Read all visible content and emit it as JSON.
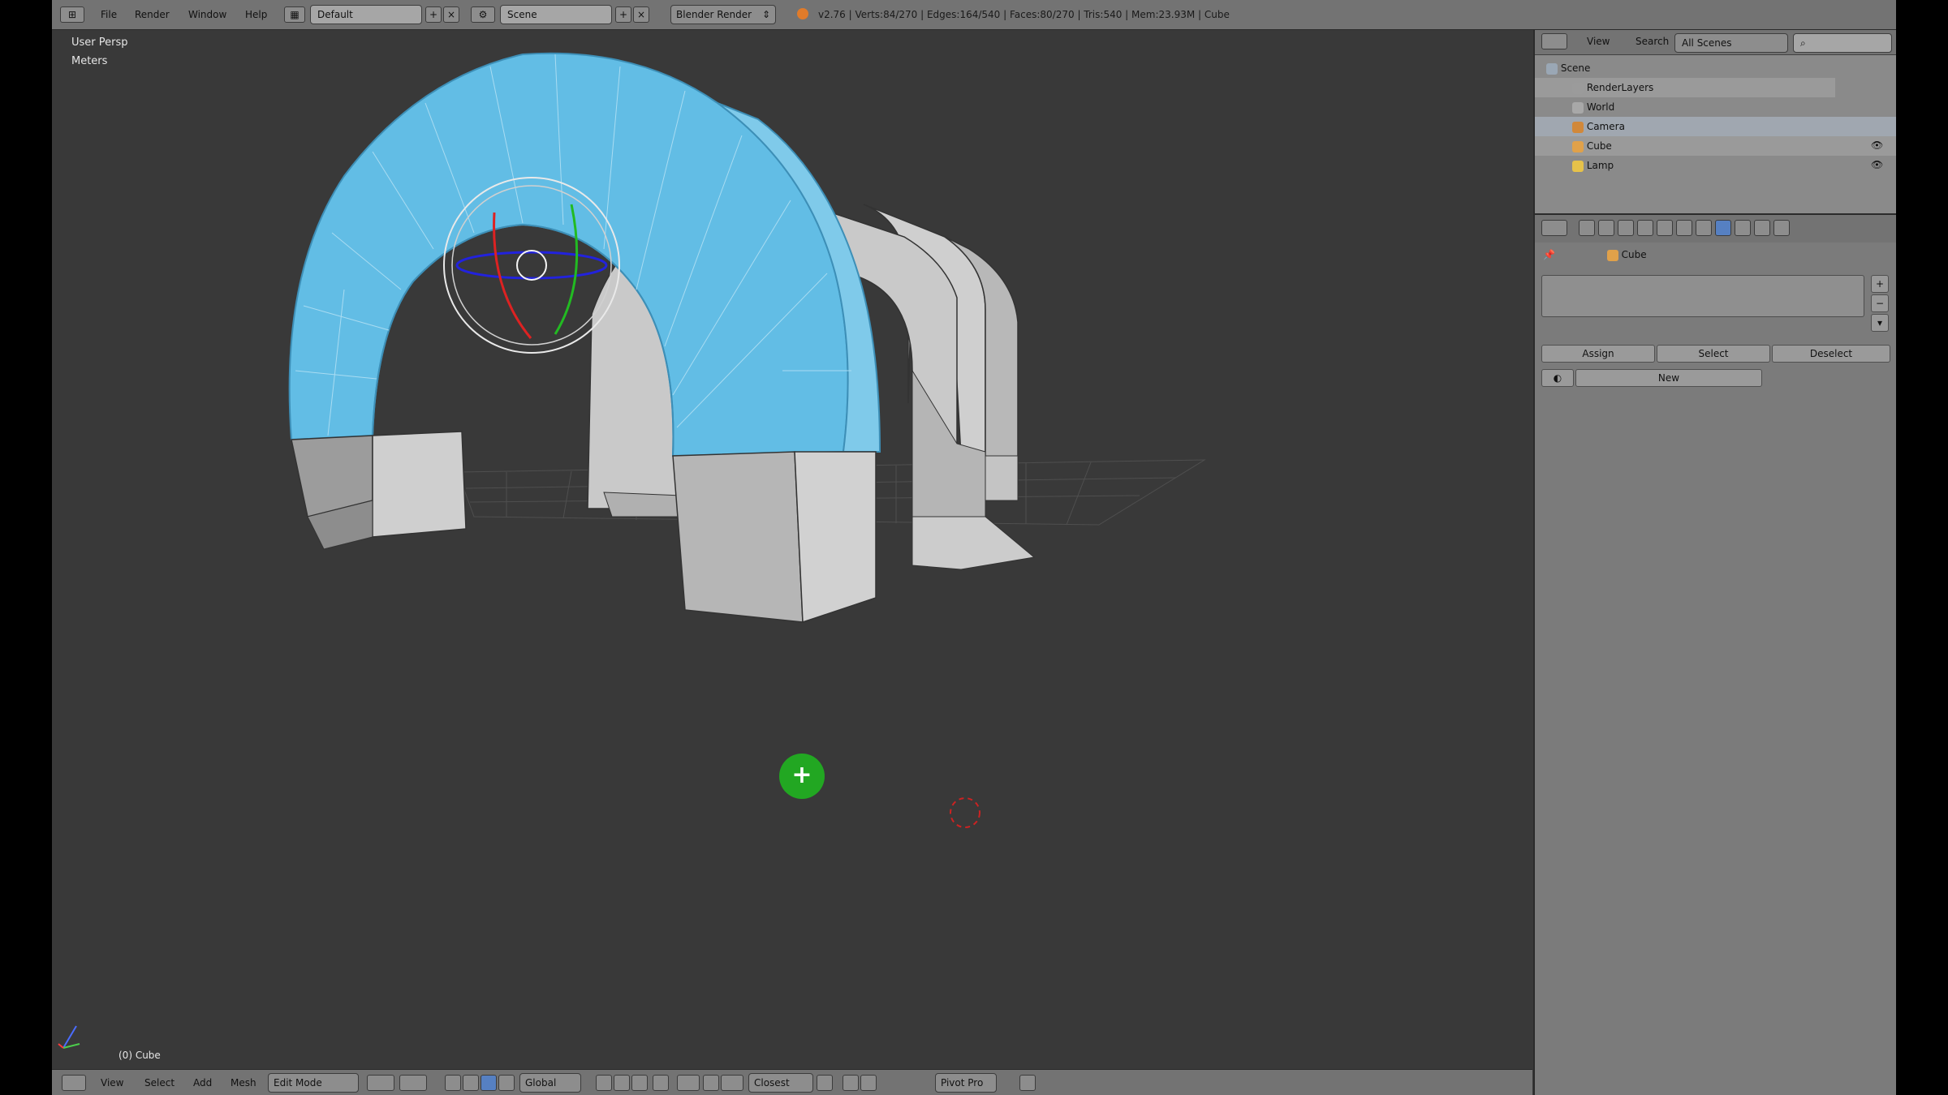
{
  "topbar": {
    "menu": [
      "File",
      "Render",
      "Window",
      "Help"
    ],
    "screen_layout": "Default",
    "scene": "Scene",
    "render_engine": "Blender Render",
    "info": "v2.76 | Verts:84/270 | Edges:164/540 | Faces:80/270 | Tris:540 | Mem:23.93M | Cube"
  },
  "viewport": {
    "view_name": "User Persp",
    "units": "Meters",
    "object_label": "(0) Cube"
  },
  "bottombar": {
    "menu": [
      "View",
      "Select",
      "Add",
      "Mesh"
    ],
    "mode": "Edit Mode",
    "orientation": "Global",
    "snap_target": "Closest",
    "pivot_label": "Pivot Pro"
  },
  "outliner": {
    "header": {
      "view": "View",
      "search": "Search",
      "scenes": "All Scenes"
    },
    "items": [
      "Scene",
      "RenderLayers",
      "World",
      "Camera",
      "Cube",
      "Lamp"
    ]
  },
  "properties": {
    "breadcrumb": "Cube",
    "buttons": {
      "assign": "Assign",
      "select": "Select",
      "deselect": "Deselect",
      "new": "New"
    }
  },
  "colors": {
    "accent_blue": "#5cb8e0",
    "viewport_bg": "#393939",
    "header": "#737373"
  }
}
